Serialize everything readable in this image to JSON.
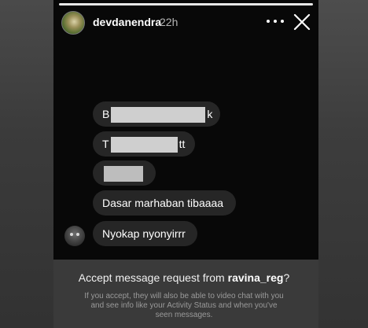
{
  "story": {
    "username": "devdanendra",
    "time_ago": "22h",
    "more_icon": "more-horizontal-icon",
    "close_icon": "close-icon"
  },
  "messages": [
    {
      "start": "B",
      "end": "k"
    },
    {
      "start": "T",
      "end": "tt"
    },
    {
      "start": "",
      "end": ""
    },
    {
      "text": "Dasar marhaban tibaaaa"
    },
    {
      "text": "Nyokap nyonyirrr"
    }
  ],
  "request": {
    "prefix": "Accept message request from ",
    "username": "ravina_reg",
    "suffix": "?",
    "description": "If you accept, they will also be able to video chat with you and see info like your Activity Status and when you've seen messages."
  },
  "colors": {
    "bubble": "#262626",
    "story_background": "#080808",
    "side_panel": "#3a3a3a"
  }
}
